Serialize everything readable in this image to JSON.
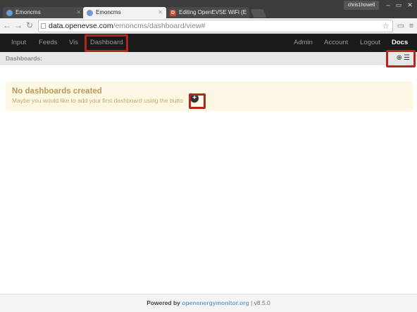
{
  "browser": {
    "tabs": [
      {
        "label": "Emoncms"
      },
      {
        "label": "Emoncms"
      },
      {
        "label": "Editing OpenEVSE WiFi (E"
      }
    ],
    "user": "chris1howell",
    "url_host": "data.openevse.com",
    "url_path": "/emoncms/dashboard/view#"
  },
  "nav": {
    "left": [
      "Input",
      "Feeds",
      "Vis",
      "Dashboard"
    ],
    "right": [
      "Admin",
      "Account",
      "Logout",
      "Docs"
    ]
  },
  "subbar": {
    "label": "Dashboards:"
  },
  "alert": {
    "title": "No dashboards created",
    "message": "Maybe you would like to add your first dashboard using the butto"
  },
  "footer": {
    "prefix": "Powered by",
    "link": "openenergymonitor.org",
    "version": "| v8.5.0"
  },
  "colors": {
    "highlight": "#b3261e",
    "navbar": "#1a1a1a",
    "alert_bg": "#fcf8e3"
  }
}
